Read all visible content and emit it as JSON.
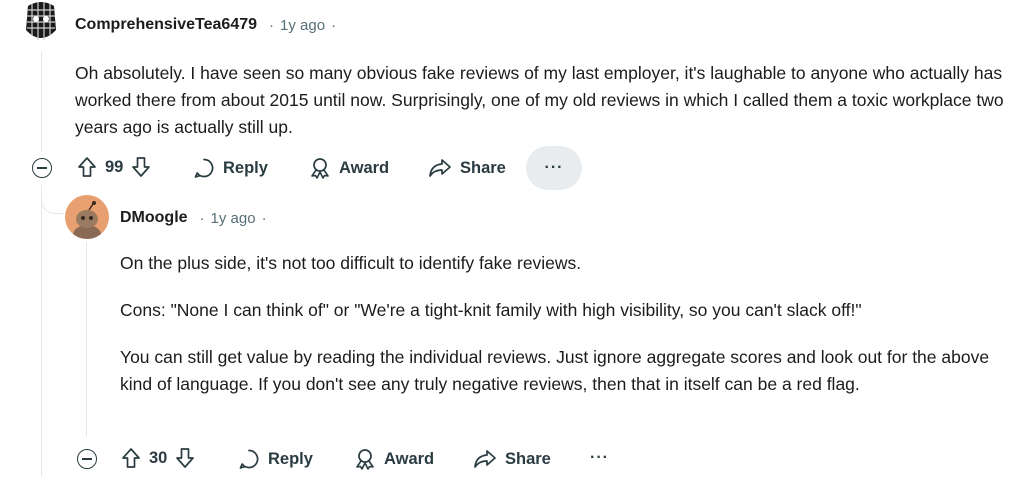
{
  "comments": [
    {
      "author": "ComprehensiveTea6479",
      "sep1": "·",
      "time": "1y ago",
      "sep2": "·",
      "paragraphs": [
        "Oh absolutely. I have seen so many obvious fake reviews of my last employer, it's laughable to anyone who actually has worked there from about 2015 until now. Surprisingly, one of my old reviews in which I called them a toxic workplace two years ago is actually still up."
      ],
      "score": "99",
      "reply_label": "Reply",
      "award_label": "Award",
      "share_label": "Share",
      "more_label": "···"
    },
    {
      "author": "DMoogle",
      "sep1": "·",
      "time": "1y ago",
      "sep2": "·",
      "paragraphs": [
        "On the plus side, it's not too difficult to identify fake reviews.",
        "Cons: \"None I can think of\" or \"We're a tight-knit family with high visibility, so you can't slack off!\"",
        "You can still get value by reading the individual reviews. Just ignore aggregate scores and look out for the above kind of language. If you don't see any truly negative reviews, then that in itself can be a red flag."
      ],
      "score": "30",
      "reply_label": "Reply",
      "award_label": "Award",
      "share_label": "Share",
      "more_label": "···"
    }
  ],
  "icons": {
    "upvote": "upvote-arrow-icon",
    "downvote": "downvote-arrow-icon",
    "reply": "speech-bubble-icon",
    "award": "award-icon",
    "share": "share-arrow-icon",
    "collapse": "collapse-minus-icon"
  },
  "colors": {
    "text": "#1c1c1c",
    "meta": "#576f76",
    "action": "#2a3c42",
    "more_bg": "#e9ecee",
    "thread_line": "#e5e7ea",
    "avatar2_bg": "#e8a070"
  }
}
